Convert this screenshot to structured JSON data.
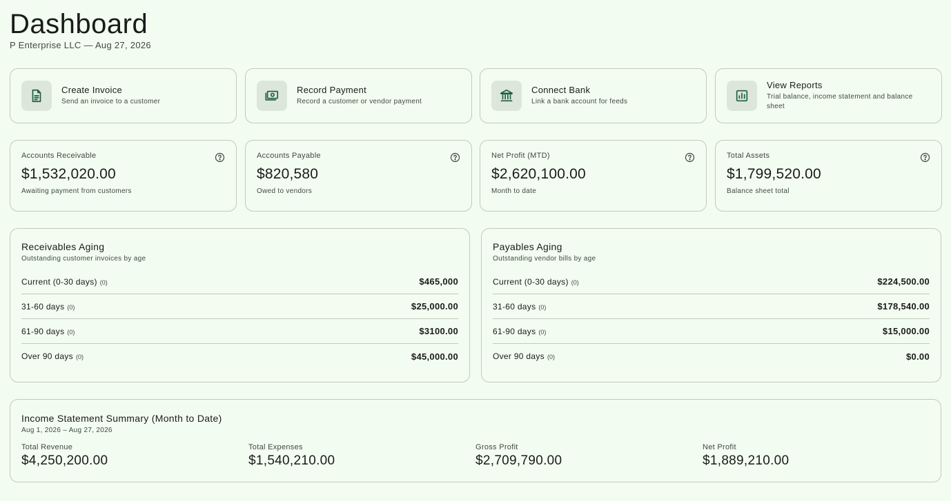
{
  "header": {
    "title": "Dashboard",
    "subtitle": "P Enterprise LLC — Aug 27, 2026"
  },
  "actions": [
    {
      "title": "Create Invoice",
      "desc": "Send an invoice to a customer",
      "icon": "document-icon"
    },
    {
      "title": "Record Payment",
      "desc": "Record a customer or vendor payment",
      "icon": "payments-icon"
    },
    {
      "title": "Connect Bank",
      "desc": "Link a bank account for feeds",
      "icon": "bank-icon"
    },
    {
      "title": "View Reports",
      "desc": "Trial balance, income statement and balance sheet",
      "icon": "chart-icon"
    }
  ],
  "kpis": [
    {
      "label": "Accounts Receivable",
      "value": "$1,532,020.00",
      "note": "Awaiting payment from customers"
    },
    {
      "label": "Accounts Payable",
      "value": "$820,580",
      "note": "Owed to vendors"
    },
    {
      "label": "Net Profit (MTD)",
      "value": "$2,620,100.00",
      "note": "Month to date"
    },
    {
      "label": "Total Assets",
      "value": "$1,799,520.00",
      "note": "Balance sheet total"
    }
  ],
  "receivables": {
    "title": "Receivables Aging",
    "subtitle": "Outstanding customer invoices by age",
    "rows": [
      {
        "label": "Current (0-30 days)",
        "count": "(0)",
        "amount": "$465,000"
      },
      {
        "label": "31-60 days",
        "count": "(0)",
        "amount": "$25,000.00"
      },
      {
        "label": "61-90 days",
        "count": "(0)",
        "amount": "$3100.00"
      },
      {
        "label": "Over 90 days",
        "count": "(0)",
        "amount": "$45,000.00"
      }
    ]
  },
  "payables": {
    "title": "Payables Aging",
    "subtitle": "Outstanding vendor bills by age",
    "rows": [
      {
        "label": "Current (0-30 days)",
        "count": "(0)",
        "amount": "$224,500.00"
      },
      {
        "label": "31-60 days",
        "count": "(0)",
        "amount": "$178,540.00"
      },
      {
        "label": "61-90 days",
        "count": "(0)",
        "amount": "$15,000.00"
      },
      {
        "label": "Over 90 days",
        "count": "(0)",
        "amount": "$0.00"
      }
    ]
  },
  "income": {
    "title": "Income Statement Summary (Month to Date)",
    "period": "Aug 1, 2026 – Aug 27, 2026",
    "metrics": [
      {
        "label": "Total Revenue",
        "value": "$4,250,200.00"
      },
      {
        "label": "Total Expenses",
        "value": "$1,540,210.00"
      },
      {
        "label": "Gross Profit",
        "value": "$2,709,790.00"
      },
      {
        "label": "Net Profit",
        "value": "$1,889,210.00"
      }
    ]
  },
  "colors": {
    "background": "#f3fcf0",
    "accent": "#1b5e3b",
    "icon_bg": "#dde6da",
    "border": "#c2c9bf"
  }
}
